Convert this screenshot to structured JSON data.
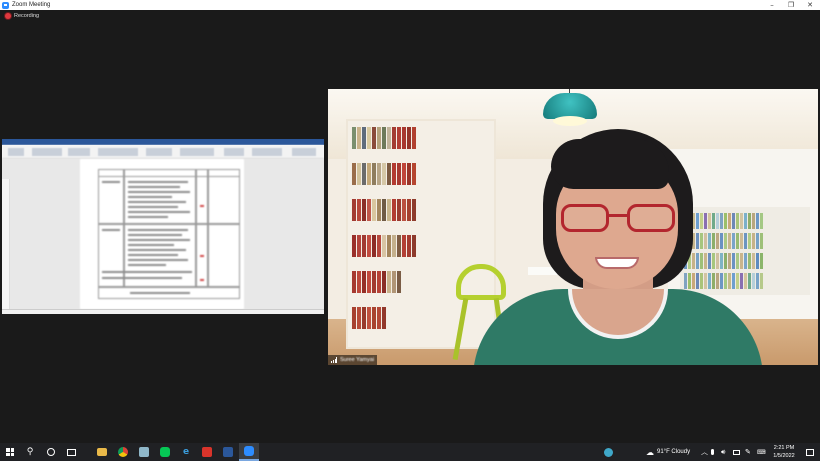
{
  "window": {
    "title": "Zoom Meeting",
    "minimize_glyph": "–",
    "maximize_glyph": "❐",
    "close_glyph": "✕"
  },
  "meeting": {
    "recording_label": "Recording",
    "recording_color": "#e0383e",
    "participant_name": "Suree Yamyai",
    "shared_window": "Microsoft Word document (blurred)"
  },
  "taskbar": {
    "pinned": [
      {
        "name": "start",
        "icon": "windows-logo-icon"
      },
      {
        "name": "search",
        "icon": "search-icon"
      },
      {
        "name": "cortana",
        "icon": "cortana-circle-icon"
      },
      {
        "name": "task-view",
        "icon": "task-view-icon"
      },
      {
        "name": "file-explorer",
        "icon": "folder-icon"
      },
      {
        "name": "chrome",
        "icon": "chrome-icon"
      },
      {
        "name": "notes",
        "icon": "notes-icon"
      },
      {
        "name": "line",
        "icon": "line-icon"
      },
      {
        "name": "edge",
        "icon": "edge-icon"
      },
      {
        "name": "acrobat",
        "icon": "pdf-icon"
      },
      {
        "name": "word",
        "icon": "word-icon"
      },
      {
        "name": "zoom",
        "icon": "zoom-icon"
      }
    ],
    "weather": "91°F  Cloudy",
    "time": "2:21 PM",
    "date": "1/5/2022"
  },
  "colors": {
    "taskbar_bg": "#202124",
    "stage_bg": "#1a1a1a",
    "zoom_blue": "#2d8cff",
    "word_blue": "#2b579a",
    "shirt_green": "#2f7a66"
  }
}
